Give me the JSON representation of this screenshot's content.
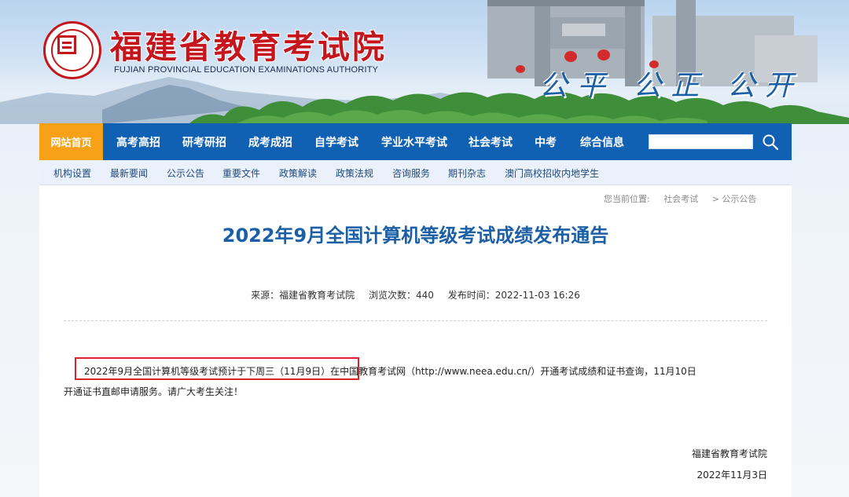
{
  "header": {
    "site_title": "福建省教育考试院",
    "site_subtitle": "FUJIAN PROVINCIAL EDUCATION EXAMINATIONS AUTHORITY",
    "motto": "公平 公正 公开"
  },
  "main_nav": {
    "home": "网站首页",
    "items": [
      "高考高招",
      "研考研招",
      "成考成招",
      "自学考试",
      "学业水平考试",
      "社会考试",
      "中考",
      "综合信息"
    ],
    "search_placeholder": ""
  },
  "sub_nav": {
    "items": [
      "机构设置",
      "最新要闻",
      "公示公告",
      "重要文件",
      "政策解读",
      "政策法规",
      "咨询服务",
      "期刊杂志",
      "澳门高校招收内地学生"
    ]
  },
  "breadcrumb": {
    "label": "您当前位置:",
    "level1": "社会考试",
    "level2": "> 公示公告"
  },
  "article": {
    "title": "2022年9月全国计算机等级考试成绩发布通告",
    "source": "来源：福建省教育考试院",
    "views": "浏览次数：440",
    "published": "发布时间：2022-11-03 16:26",
    "paragraph_line1": "2022年9月全国计算机等级考试预计于下周三（11月9日）在中国教育考试网（http://www.neea.edu.cn/）开通考试成绩和证书查询，11月10日",
    "paragraph_line2": "开通证书直邮申请服务。请广大考生关注！",
    "signature_org": "福建省教育考试院",
    "signature_date": "2022年11月3日"
  },
  "colors": {
    "brand_red": "#c4161c",
    "nav_blue": "#1060b4",
    "home_orange": "#f6a117",
    "title_blue": "#1b5fa6",
    "highlight_red": "#d8262b"
  }
}
